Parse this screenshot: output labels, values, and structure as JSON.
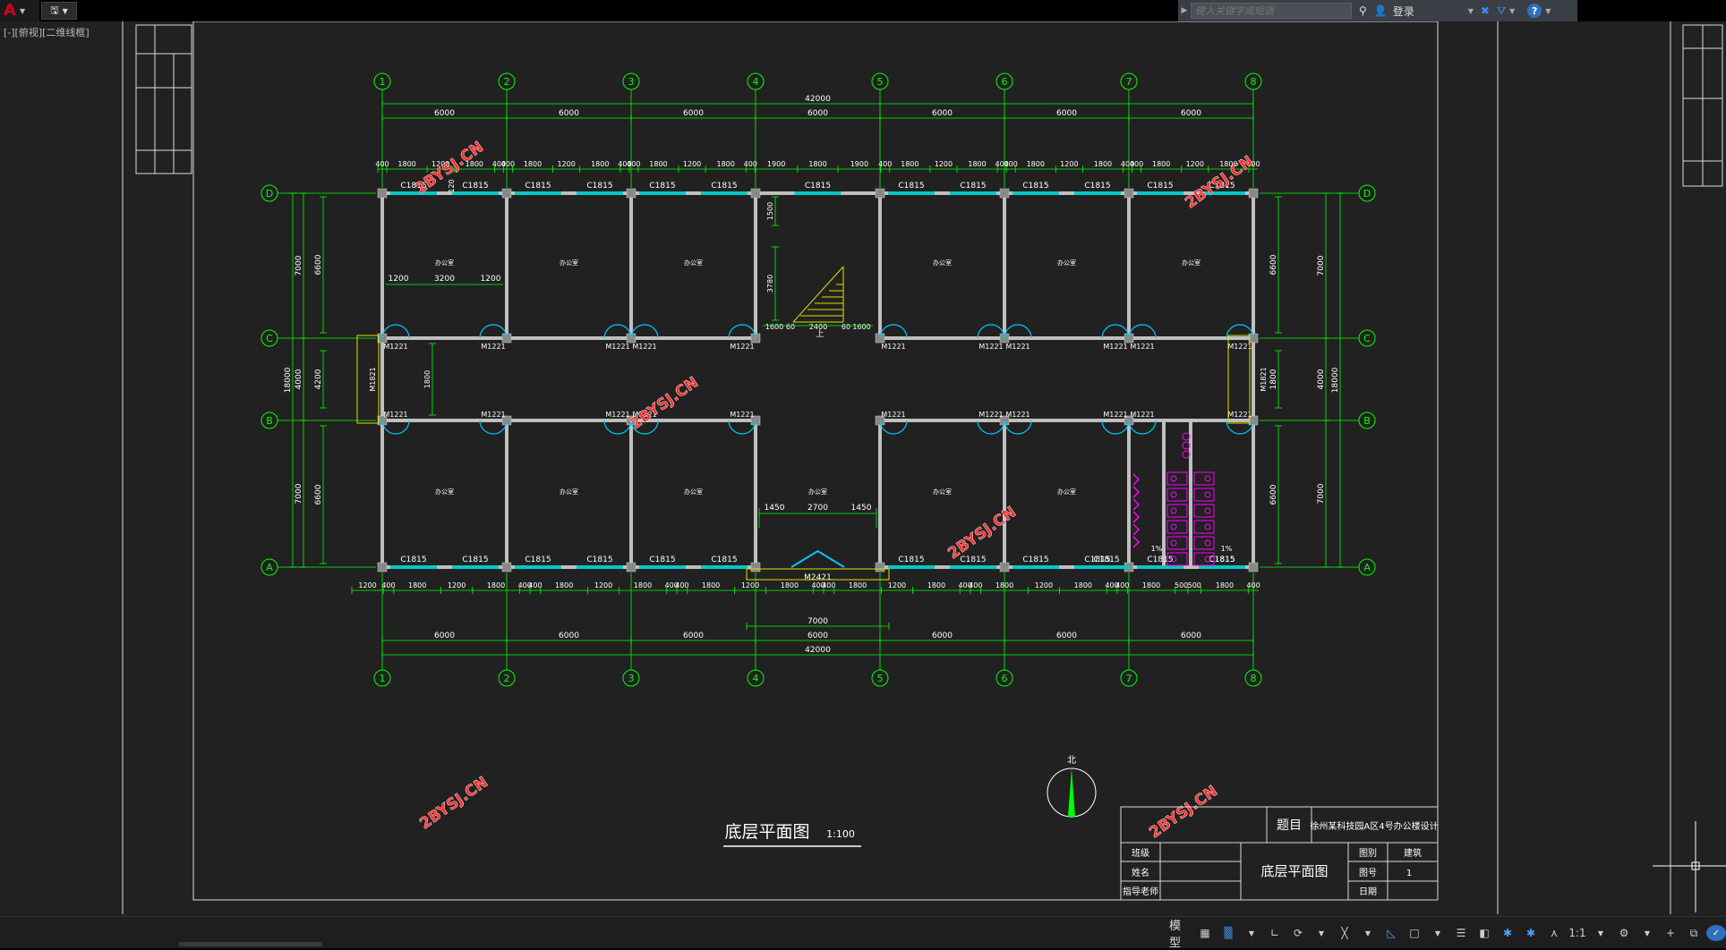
{
  "window": {
    "app_logo": "A",
    "qat_icon": "save-icon",
    "search_placeholder": "键入关键字或短语",
    "login_label": "登录",
    "help_label": "?"
  },
  "viewport_label": "[-][俯视][二维线框]",
  "drawing": {
    "axes_columns": [
      "1",
      "2",
      "3",
      "4",
      "5",
      "6",
      "7",
      "8"
    ],
    "axes_rows": [
      "D",
      "C",
      "B",
      "A"
    ],
    "total_length": "42000",
    "bay_dims": [
      "6000",
      "6000",
      "6000",
      "6000",
      "6000",
      "6000",
      "6000"
    ],
    "top_detail_dims": [
      "400",
      "1800",
      "1200",
      "1800",
      "400",
      "400",
      "1800",
      "1200",
      "1800",
      "400",
      "400",
      "1800",
      "1200",
      "1800",
      "400",
      "1900",
      "1800",
      "1900",
      "400",
      "1800",
      "1200",
      "1800",
      "400",
      "400",
      "1800",
      "1200",
      "1800",
      "400",
      "400",
      "1800",
      "1200",
      "1800",
      "400"
    ],
    "bottom_detail_dims": [
      "1200",
      "400",
      "1800",
      "1200",
      "1800",
      "400",
      "400",
      "1800",
      "1200",
      "1800",
      "400",
      "400",
      "1800",
      "1200",
      "1800",
      "400",
      "400",
      "1800",
      "1200",
      "1800",
      "400",
      "400",
      "1800",
      "1200",
      "1800",
      "400",
      "400",
      "1800",
      "500",
      "500",
      "1800",
      "400"
    ],
    "left_dims": [
      "7000",
      "4000",
      "7000"
    ],
    "left_inner_dims": [
      "6600",
      "4200",
      "6600"
    ],
    "left_total": "18000",
    "right_dims": [
      "7000",
      "4000",
      "7000"
    ],
    "right_inner_dims": [
      "6600",
      "1800",
      "6600"
    ],
    "right_total": "18000",
    "windows_top": [
      "C1815",
      "C1815",
      "C1815",
      "C1815",
      "C1815",
      "C1815",
      "C1815",
      "C1815",
      "C1815",
      "C1815",
      "C1815",
      "C1815",
      "C1815"
    ],
    "windows_bottom": [
      "C1815",
      "C1815",
      "C1815",
      "C1815",
      "C1815",
      "C1815",
      "C1815",
      "C1815",
      "C1815",
      "C1815",
      "C1815",
      "C1815",
      "C1815",
      "C1815"
    ],
    "doors_upper": [
      "M1221",
      "M1221",
      "M1221",
      "M1221",
      "M1221",
      "M1221",
      "M1221",
      "M1221",
      "M1221",
      "M1221",
      "M1221",
      "M1221"
    ],
    "doors_lower": [
      "M1221",
      "M1221",
      "M1221",
      "M1221",
      "M1221",
      "M1221",
      "M1221",
      "M1221",
      "M1221",
      "M1221",
      "M1221",
      "M1221"
    ],
    "side_door": "M1821",
    "main_door": "M2421",
    "room_label": "办公室",
    "stair_dims": [
      "1600",
      "60",
      "2400",
      "60",
      "1600"
    ],
    "stair_height_dims": [
      "1500",
      "3780"
    ],
    "stair_up": "上",
    "lobby_dims": [
      "1450",
      "2700",
      "1450"
    ],
    "entrance_dim": "7000",
    "room_dims": [
      "1200",
      "3200",
      "1200"
    ],
    "side_dims": [
      "900",
      "1800",
      "900"
    ],
    "slope_label": "1%",
    "top_small_dim": "120",
    "watermark": "2BYSJ.CN",
    "plan_title": "底层平面图",
    "plan_scale": "1:100",
    "north_label": "北"
  },
  "title_block": {
    "subject_label": "题目",
    "subject_value": "徐州某科技园A区4号办公楼设计",
    "drawing_name": "底层平面图",
    "class_label": "班级",
    "name_label": "姓名",
    "tutor_label": "指导老师",
    "category_label": "图别",
    "category_value": "建筑",
    "number_label": "图号",
    "number_value": "1",
    "date_label": "日期"
  },
  "statusbar": {
    "model_label": "模型",
    "scale_label": "1:1"
  },
  "colors": {
    "background": "#000000",
    "canvas": "#212121",
    "axis_green": "#00ff00",
    "wall": "#bfbfbf",
    "window": "#00c8c8",
    "door": "#00c8ff",
    "stair": "#e0e000",
    "toilet": "#ff00ff",
    "watermark": "#ff3030",
    "white": "#ffffff"
  }
}
